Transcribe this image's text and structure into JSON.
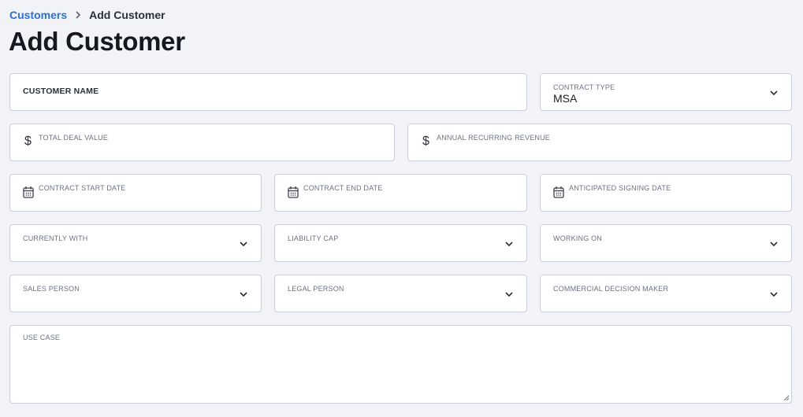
{
  "breadcrumb": {
    "parent": "Customers",
    "current": "Add Customer"
  },
  "page_title": "Add Customer",
  "fields": {
    "customer_name": {
      "label": "CUSTOMER NAME",
      "value": ""
    },
    "contract_type": {
      "label": "CONTRACT TYPE",
      "value": "MSA"
    },
    "total_deal_value": {
      "label": "TOTAL DEAL VALUE",
      "prefix": "$",
      "value": ""
    },
    "annual_recurring_revenue": {
      "label": "ANNUAL RECURRING REVENUE",
      "prefix": "$",
      "value": ""
    },
    "contract_start_date": {
      "label": "CONTRACT START DATE",
      "value": ""
    },
    "contract_end_date": {
      "label": "CONTRACT END DATE",
      "value": ""
    },
    "anticipated_signing_date": {
      "label": "ANTICIPATED SIGNING DATE",
      "value": ""
    },
    "currently_with": {
      "label": "CURRENTLY WITH",
      "value": ""
    },
    "liability_cap": {
      "label": "LIABILITY CAP",
      "value": ""
    },
    "working_on": {
      "label": "WORKING ON",
      "value": ""
    },
    "sales_person": {
      "label": "SALES PERSON",
      "value": ""
    },
    "legal_person": {
      "label": "LEGAL PERSON",
      "value": ""
    },
    "commercial_decision_maker": {
      "label": "COMMERCIAL DECISION MAKER",
      "value": ""
    },
    "use_case": {
      "label": "USE CASE",
      "value": ""
    }
  },
  "icons": {
    "breadcrumb_separator": "chevron-right-icon",
    "date": "calendar-icon",
    "dropdown": "chevron-down-icon"
  },
  "colors": {
    "link": "#2d6fd6",
    "background": "#f1f3f7",
    "border": "#c9ced8"
  }
}
